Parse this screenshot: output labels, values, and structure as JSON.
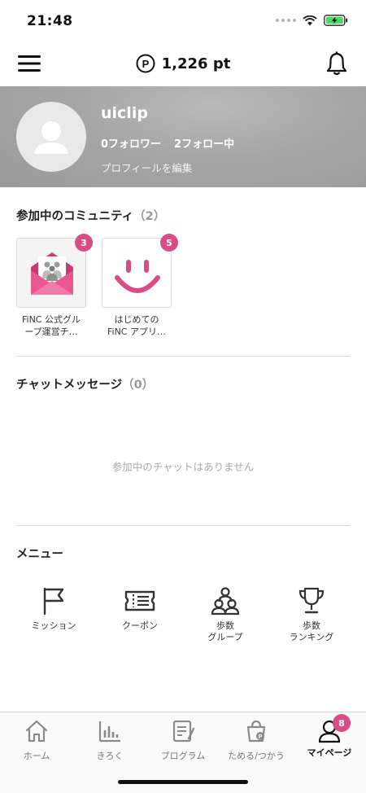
{
  "status_bar": {
    "time": "21:48"
  },
  "header": {
    "points": "1,226 pt",
    "points_icon_letter": "P"
  },
  "profile": {
    "username": "uiclip",
    "followers": "0フォロワー",
    "following": "2フォロー中",
    "edit_label": "プロフィールを編集"
  },
  "communities": {
    "title": "参加中のコミュニティ",
    "count": "（2）",
    "items": [
      {
        "name_line1": "FiNC 公式グル",
        "name_line2": "ープ運営チ…",
        "badge": "3"
      },
      {
        "name_line1": "はじめての",
        "name_line2": "FiNC アプリ…",
        "badge": "5"
      }
    ]
  },
  "chat": {
    "title": "チャットメッセージ",
    "count": "（0）",
    "empty_text": "参加中のチャットはありません"
  },
  "menu": {
    "title": "メニュー",
    "items": [
      {
        "line1": "ミッション",
        "line2": "",
        "icon": "flag-icon"
      },
      {
        "line1": "クーポン",
        "line2": "",
        "icon": "coupon-icon"
      },
      {
        "line1": "歩数",
        "line2": "グループ",
        "icon": "group-icon"
      },
      {
        "line1": "歩数",
        "line2": "ランキング",
        "icon": "trophy-icon"
      }
    ]
  },
  "tabs": [
    {
      "label": "ホーム",
      "icon": "home-icon"
    },
    {
      "label": "きろく",
      "icon": "chart-icon"
    },
    {
      "label": "プログラム",
      "icon": "program-icon"
    },
    {
      "label": "ためる/つかう",
      "icon": "bag-icon"
    },
    {
      "label": "マイページ",
      "icon": "person-icon",
      "badge": "8"
    }
  ],
  "colors": {
    "accent": "#d84d84",
    "banner": "#a6a6a6"
  }
}
